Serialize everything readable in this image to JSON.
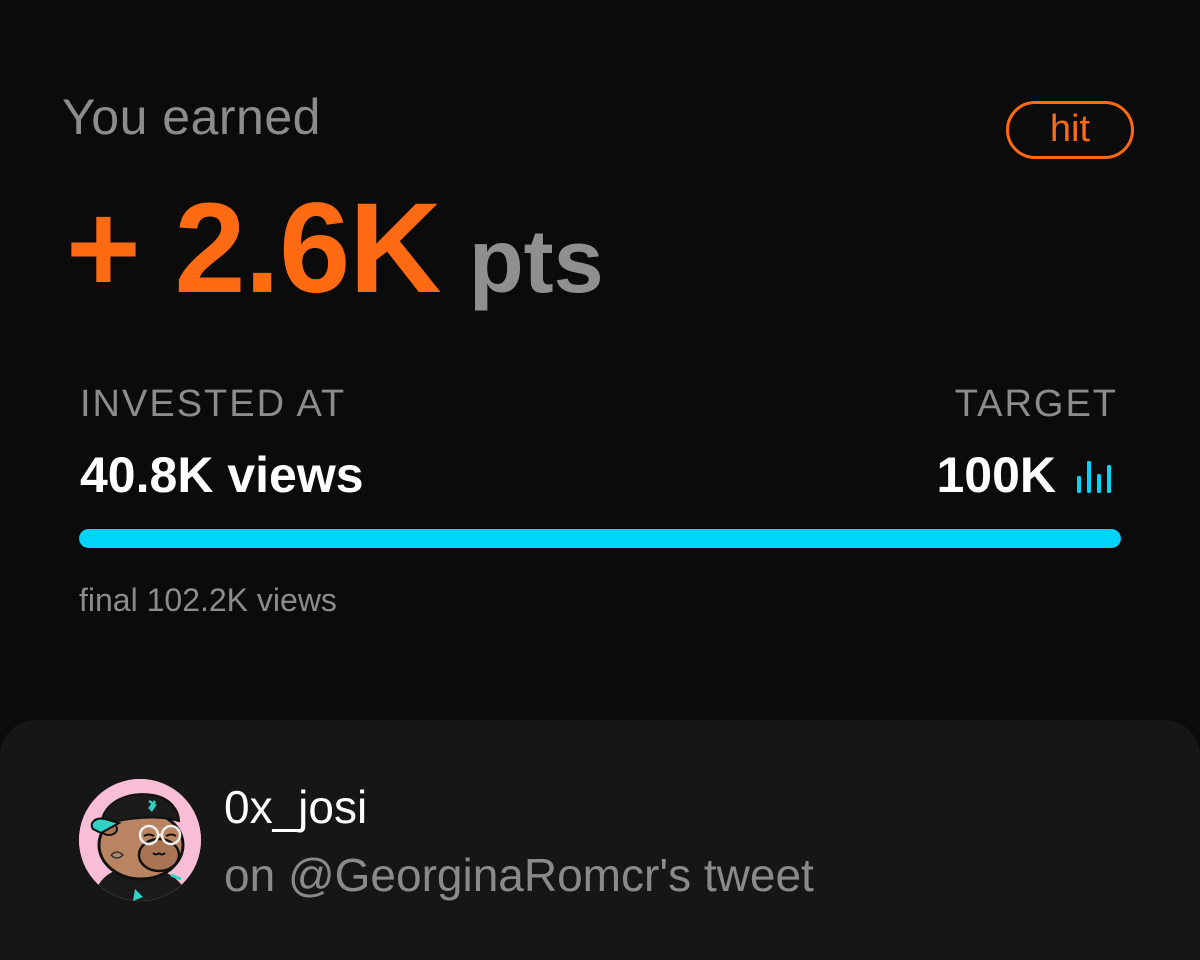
{
  "earned": {
    "label": "You earned",
    "value": "+ 2.6K",
    "unit": "pts"
  },
  "status_badge": {
    "label": "hit"
  },
  "invested": {
    "label": "INVESTED AT",
    "value": "40.8K views"
  },
  "target": {
    "label": "TARGET",
    "value": "100K",
    "icon": "bar-chart-icon"
  },
  "progress": {
    "fill_fraction": 1.0
  },
  "final": {
    "text": "final 102.2K views"
  },
  "post": {
    "username": "0x_josi",
    "context": "on @GeorginaRomcr's tweet",
    "avatar_icon": "capybara-avatar"
  },
  "colors": {
    "accent_orange": "#ff6a13",
    "accent_cyan": "#00d4fb",
    "background": "#0b0b0b",
    "card_background": "#161616",
    "muted_text": "#8c8c8c",
    "avatar_background": "#f7bed5"
  }
}
